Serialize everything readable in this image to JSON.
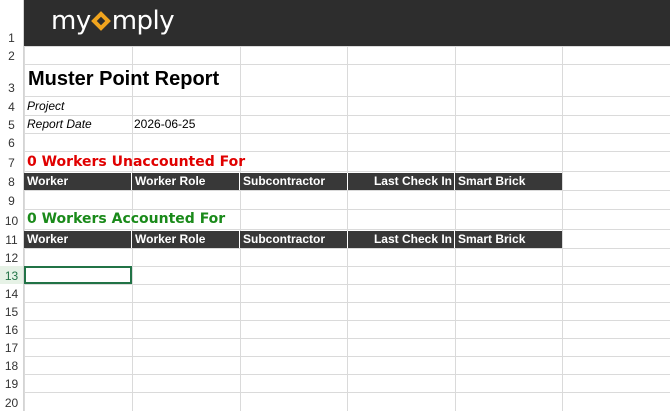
{
  "brand": {
    "logo_text_before": "my",
    "logo_text_after": "mply",
    "logo_accent": "#f0a41e"
  },
  "rows": [
    "1",
    "2",
    "3",
    "4",
    "5",
    "6",
    "7",
    "8",
    "9",
    "10",
    "11",
    "12",
    "13",
    "14",
    "15",
    "16",
    "17",
    "18",
    "19",
    "20"
  ],
  "selected_row": "13",
  "report": {
    "title": "Muster Point Report",
    "project_label": "Project",
    "project_value": "",
    "date_label": "Report Date",
    "date_value": "2026-06-25"
  },
  "unaccounted": {
    "heading": "0 Workers Unaccounted For",
    "color": "#e00000",
    "columns": [
      "Worker",
      "Worker Role",
      "Subcontractor",
      "Last Check In",
      "Smart Brick"
    ]
  },
  "accounted": {
    "heading": "0 Workers Accounted For",
    "color": "#1a8a1a",
    "columns": [
      "Worker",
      "Worker Role",
      "Subcontractor",
      "Last Check In",
      "Smart Brick"
    ]
  }
}
